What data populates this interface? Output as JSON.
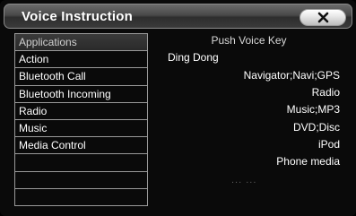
{
  "window": {
    "title": "Voice Instruction",
    "close_icon": "close-x-icon"
  },
  "sidebar": {
    "header": "Applications",
    "items": [
      {
        "label": "Action"
      },
      {
        "label": "Bluetooth Call"
      },
      {
        "label": "Bluetooth Incoming"
      },
      {
        "label": "Radio"
      },
      {
        "label": "Music"
      },
      {
        "label": "Media Control"
      },
      {
        "label": ""
      },
      {
        "label": ""
      },
      {
        "label": ""
      }
    ]
  },
  "content": {
    "heading": "Push Voice Key",
    "prompt": "Ding Dong",
    "commands": [
      "Navigator;Navi;GPS",
      "Radio",
      "Music;MP3",
      "DVD;Disc",
      "iPod",
      "Phone media"
    ],
    "more_indicator": "... ..."
  }
}
